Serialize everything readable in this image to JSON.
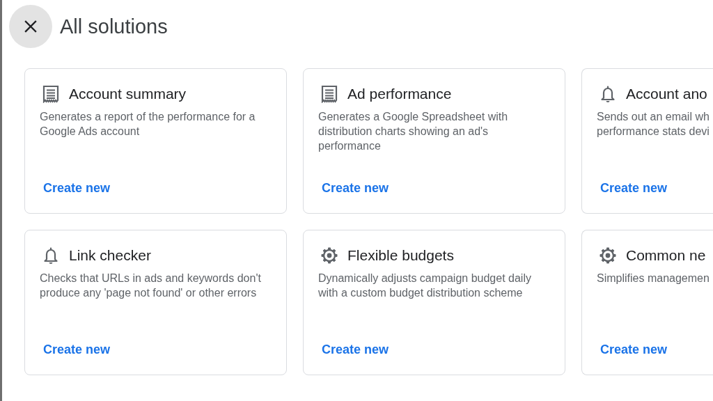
{
  "header": {
    "title": "All solutions"
  },
  "cards": [
    {
      "kind": "report",
      "title": "Account summary",
      "description": [
        "Generates a report of the performance for a",
        "Google Ads account"
      ],
      "action": "Create new"
    },
    {
      "kind": "report",
      "title": "Ad performance",
      "description": [
        "Generates a Google Spreadsheet with",
        "distribution charts showing an ad's",
        "performance"
      ],
      "action": "Create new"
    },
    {
      "kind": "alert",
      "title": "Account ano",
      "description": [
        "Sends out an email wh",
        "performance stats devi"
      ],
      "action": "Create new"
    },
    {
      "kind": "alert",
      "title": "Link checker",
      "description": [
        "Checks that URLs in ads and keywords don't",
        "produce any 'page not found' or other errors"
      ],
      "action": "Create new"
    },
    {
      "kind": "automation",
      "title": "Flexible budgets",
      "description": [
        "Dynamically adjusts campaign budget daily",
        "with a custom budget distribution scheme"
      ],
      "action": "Create new"
    },
    {
      "kind": "automation",
      "title": "Common ne",
      "description": [
        "Simplifies managemen"
      ],
      "action": "Create new"
    }
  ]
}
